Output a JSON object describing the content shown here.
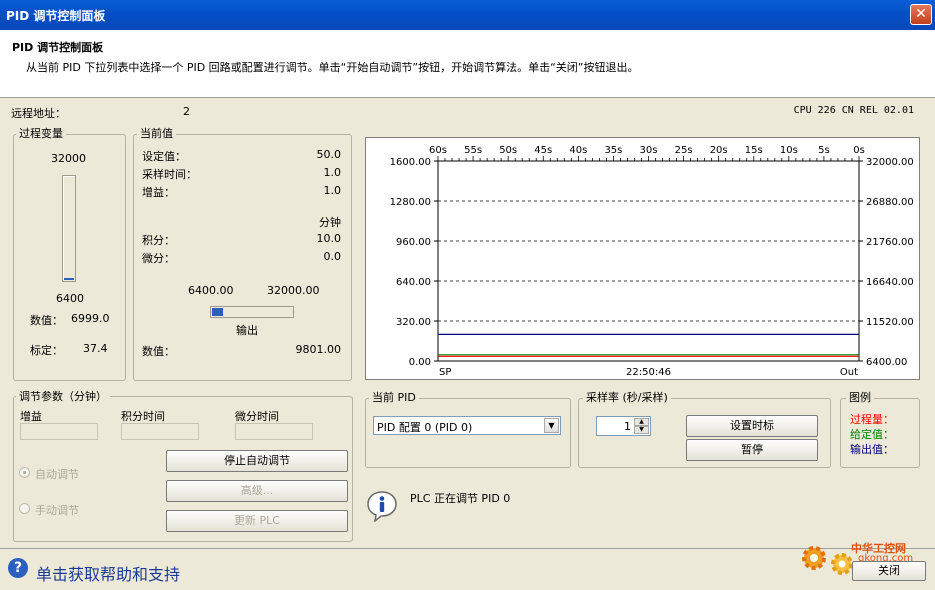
{
  "window": {
    "title": "PID 调节控制面板",
    "close_glyph": "✕"
  },
  "header": {
    "title": "PID 调节控制面板",
    "desc": "从当前 PID 下拉列表中选择一个 PID 回路或配置进行调节。单击“开始自动调节”按钮，开始调节算法。单击“关闭”按钮退出。"
  },
  "remote": {
    "label": "远程地址：",
    "value": "2",
    "cpu": "CPU 226 CN REL 02.01"
  },
  "pv": {
    "legend": "过程变量",
    "max": "32000",
    "min": "6400",
    "level": 0.023,
    "value_label": "数值：",
    "value": "6999.0",
    "scaled_label": "标定：",
    "scaled": "37.4"
  },
  "current": {
    "legend": "当前值",
    "setpoint_label": "设定值：",
    "setpoint": "50.0",
    "sample_label": "采样时间：",
    "sample": "1.0",
    "gain_label": "增益：",
    "gain": "1.0",
    "unit": "分钟",
    "integral_label": "积分：",
    "integral": "10.0",
    "derivative_label": "微分：",
    "derivative": "0.0",
    "out_min": "6400.00",
    "out_max": "32000.00",
    "out_level": 0.132,
    "out_label": "输出",
    "value_label": "数值：",
    "value": "9801.00"
  },
  "chart_data": {
    "type": "line",
    "top_ticks": [
      "60s",
      "55s",
      "50s",
      "45s",
      "40s",
      "35s",
      "30s",
      "25s",
      "20s",
      "15s",
      "10s",
      "5s",
      "0s"
    ],
    "left_ticks": [
      "1600.00",
      "1280.00",
      "960.00",
      "640.00",
      "320.00",
      "0.00"
    ],
    "right_ticks": [
      "32000.00",
      "26880.00",
      "21760.00",
      "16640.00",
      "11520.00",
      "6400.00"
    ],
    "ylim_left": [
      0,
      1600
    ],
    "ylim_right": [
      6400,
      32000
    ],
    "bottom_left": "SP",
    "bottom_center": "22:50:46",
    "bottom_right": "Out",
    "grid": "dashed horizontal",
    "series": [
      {
        "name": "过程量",
        "color": "#ff0000",
        "values": [
          37.4,
          37.4
        ]
      },
      {
        "name": "给定值",
        "color": "#008000",
        "values": [
          50.0,
          50.0
        ]
      },
      {
        "name": "输出值",
        "color": "#000080",
        "values": [
          9801.0,
          9801.0
        ],
        "axis": "right"
      }
    ]
  },
  "tuning": {
    "legend": "调节参数（分钟）",
    "gain_label": "增益",
    "integral_label": "积分时间",
    "derivative_label": "微分时间",
    "auto_label": "自动调节",
    "manual_label": "手动调节",
    "stop_button": "停止自动调节",
    "advanced_button": "高级...",
    "update_button": "更新 PLC"
  },
  "current_pid": {
    "legend": "当前 PID",
    "selected": "PID 配置 0 (PID 0)"
  },
  "sampling": {
    "legend": "采样率 (秒/采样)",
    "value": "1",
    "set_marker": "设置时标",
    "pause": "暂停"
  },
  "legend_box": {
    "legend": "图例",
    "items": [
      {
        "label": "过程量：",
        "color": "#ff0000"
      },
      {
        "label": "给定值：",
        "color": "#008000"
      },
      {
        "label": "输出值：",
        "color": "#000080"
      }
    ]
  },
  "status": {
    "icon": "info-icon",
    "text": "PLC 正在调节 PID 0"
  },
  "footer": {
    "help_text": "单击获取帮助和支持",
    "close_button": "关闭",
    "watermark_brand": "中华工控网",
    "watermark_url": "gkong.com"
  }
}
